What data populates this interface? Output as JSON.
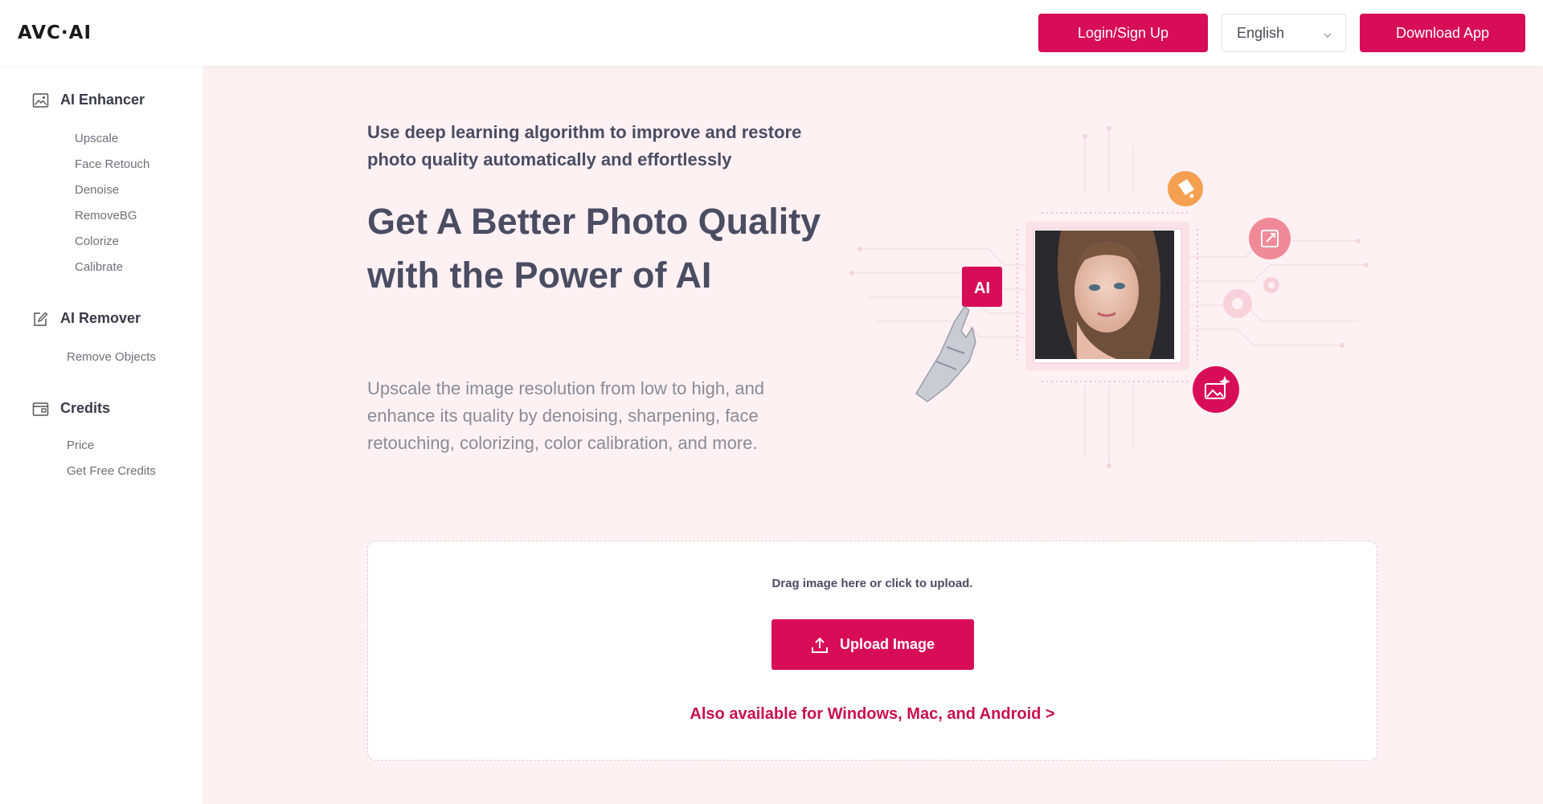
{
  "header": {
    "logo": "AVC·AI",
    "login_label": "Login/Sign Up",
    "language": "English",
    "download_label": "Download App"
  },
  "sidebar": {
    "sections": [
      {
        "title": "AI Enhancer",
        "icon": "image-icon",
        "items": [
          "Upscale",
          "Face Retouch",
          "Denoise",
          "RemoveBG",
          "Colorize",
          "Calibrate"
        ]
      },
      {
        "title": "AI Remover",
        "icon": "edit-icon",
        "items": [
          "Remove Objects"
        ]
      },
      {
        "title": "Credits",
        "icon": "wallet-icon",
        "items": [
          "Price",
          "Get Free Credits"
        ]
      }
    ]
  },
  "hero": {
    "intro": "Use deep learning algorithm to improve and restore photo quality automatically and effortlessly",
    "title": "Get A Better Photo Quality with the Power of AI",
    "description": "Upscale the image resolution from low to high, and enhance its quality by denoising, sharpening, face retouching, colorizing, color calibration, and more.",
    "ai_badge": "AI"
  },
  "upload": {
    "hint": "Drag image here or click to upload.",
    "button_label": "Upload Image",
    "also_available": "Also available for Windows, Mac, and Android >"
  },
  "colors": {
    "brand": "#d80d58",
    "page_bg": "#fdf1f4",
    "orange_accent": "#f5a050",
    "pink_accent": "#f08a98"
  }
}
